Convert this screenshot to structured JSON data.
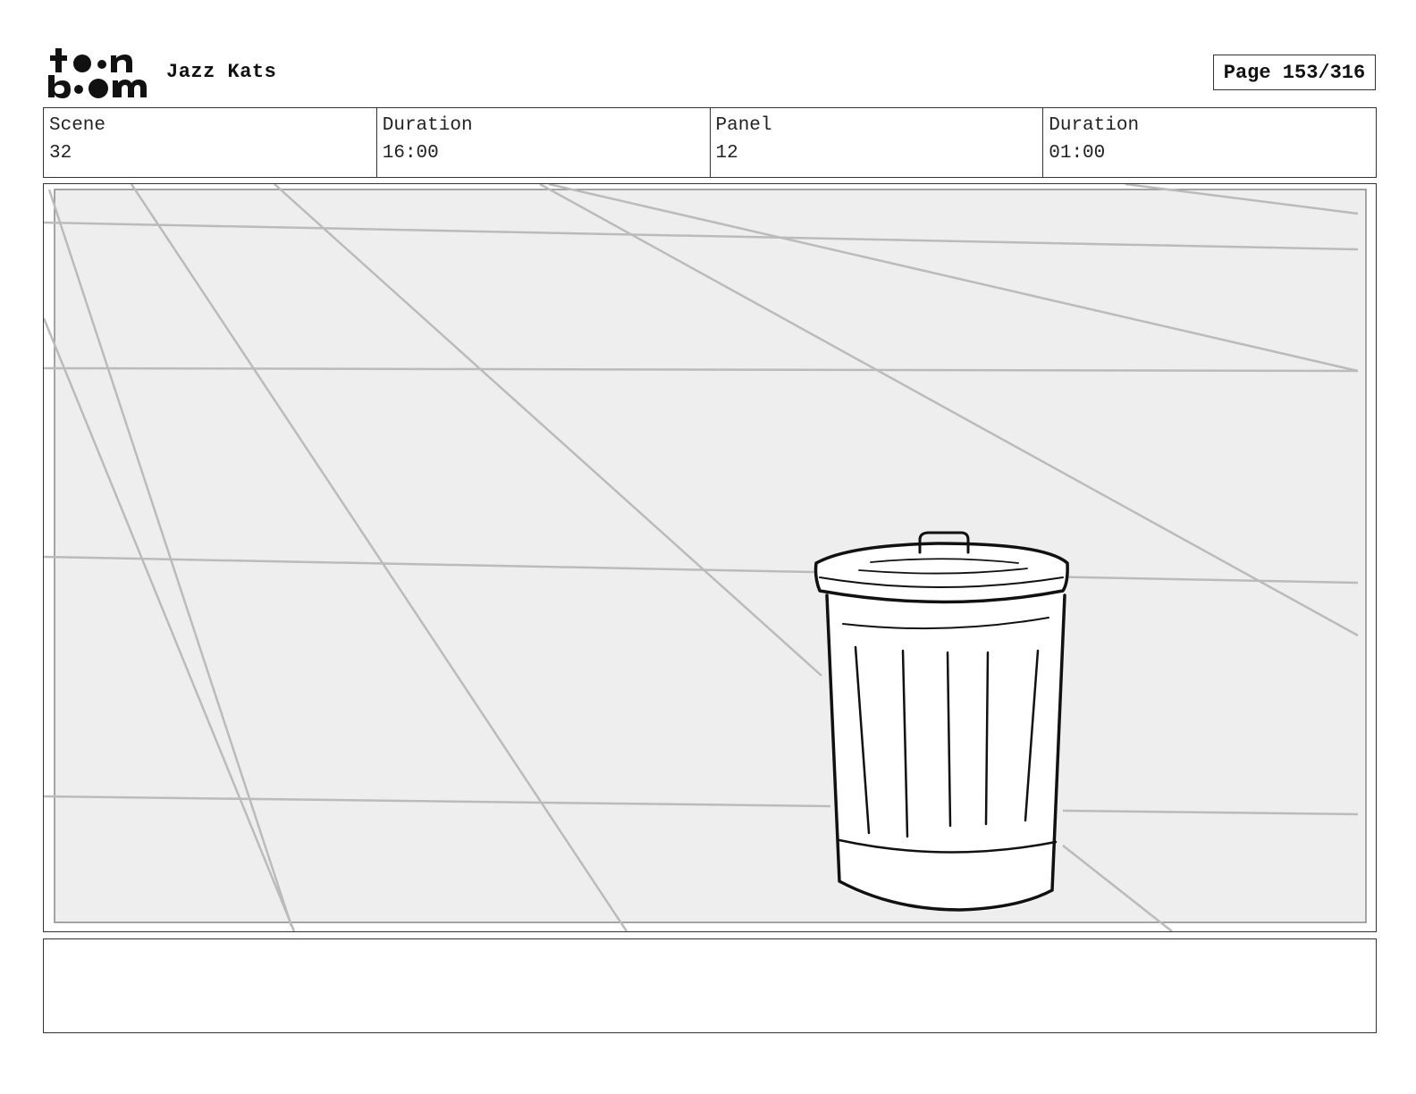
{
  "header": {
    "project_title": "Jazz Kats",
    "page_indicator": "Page 153/316"
  },
  "logo": {
    "icon": "toon-boom-logo",
    "text_top": "toon",
    "text_bottom": "boom"
  },
  "info": {
    "scene_label": "Scene",
    "scene_value": "32",
    "scene_duration_label": "Duration",
    "scene_duration_value": "16:00",
    "panel_label": "Panel",
    "panel_value": "12",
    "panel_duration_label": "Duration",
    "panel_duration_value": "01:00"
  },
  "panel": {
    "drawing": "trash-can-on-tiled-floor",
    "background_color": "#eeeeee",
    "line_color": "#bbbbbb",
    "ink_color": "#111111"
  },
  "notes": {
    "text": ""
  }
}
